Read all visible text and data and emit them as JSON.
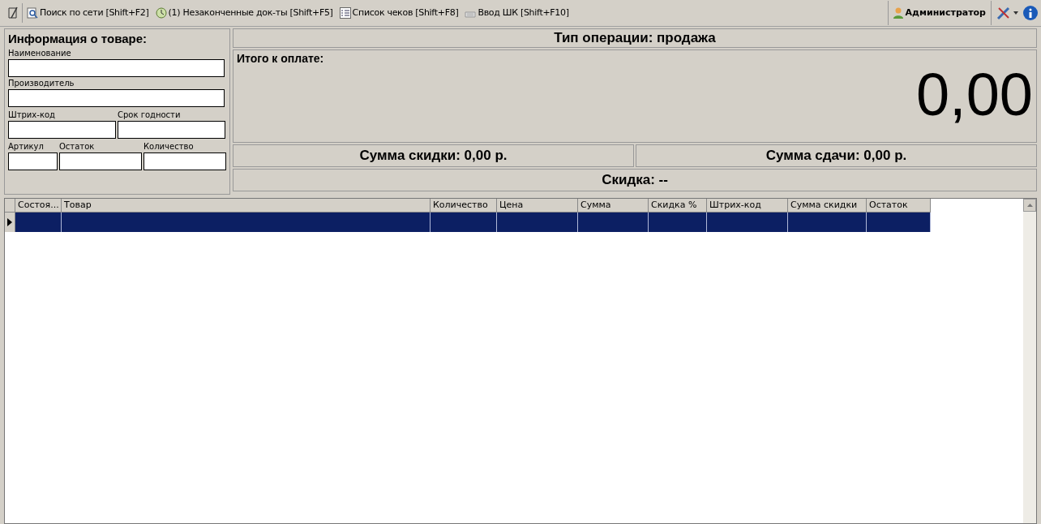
{
  "toolbar": {
    "items": [
      {
        "kind": "search",
        "label": "Поиск по сети [Shift+F2]"
      },
      {
        "kind": "clock",
        "label": "(1) Незаконченные док-ты [Shift+F5]"
      },
      {
        "kind": "list",
        "label": "Список чеков [Shift+F8]"
      },
      {
        "kind": "keyboard",
        "label": "Ввод ШК [Shift+F10]"
      }
    ],
    "user": "Администратор"
  },
  "product_info": {
    "title": "Информация о товаре:",
    "field_rows": [
      [
        {
          "label": "Наименование"
        }
      ],
      [
        {
          "label": "Производитель"
        }
      ],
      [
        {
          "label": "Штрих-код"
        },
        {
          "label": "Срок годности"
        }
      ],
      [
        {
          "label": "Артикул"
        },
        {
          "label": "Остаток"
        },
        {
          "label": "Количество"
        }
      ]
    ]
  },
  "operation": {
    "title": "Тип операции: продажа",
    "total_label": "Итого к оплате:",
    "total": "0,00",
    "discount_sum": "Сумма скидки: 0,00 р.",
    "change_sum": "Сумма сдачи: 0,00 р.",
    "discount": "Скидка: --"
  },
  "table": {
    "columns": [
      "Состоя...",
      "Товар",
      "Количество",
      "Цена",
      "Сумма",
      "Скидка %",
      "Штрих-код",
      "Сумма скидки",
      "Остаток"
    ],
    "rows": [
      {
        "selected": true
      }
    ]
  }
}
